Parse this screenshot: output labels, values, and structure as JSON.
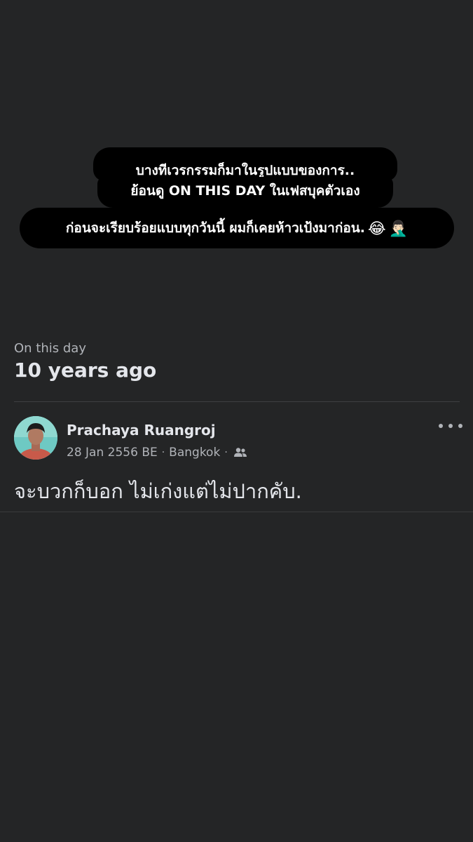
{
  "caption": {
    "line1": "บางทีเวรกรรมก็มาในรูปแบบของการ..",
    "line2": "ย้อนดู ON THIS DAY ในเฟสบุคตัวเอง",
    "line3": "ก่อนจะเรียบร้อยแบบทุกวันนี้ ผมก็เคยห้าวเป้งมาก่อน.",
    "emoji1": "😂",
    "emoji2": "🤦🏻‍♂️"
  },
  "memory": {
    "label": "On this day",
    "heading": "10 years ago"
  },
  "post": {
    "author": "Prachaya Ruangroj",
    "date": "28 Jan 2556 BE",
    "location": "Bangkok",
    "separator": "·",
    "audience_icon": "friends-icon",
    "more_icon": "more-options-icon",
    "text": "จะบวกก็บอก ไม่เก่งแต่ไม่ปากคับ."
  },
  "colors": {
    "background": "#242526",
    "caption_bg": "#000000",
    "primary_text": "#e4e6eb",
    "secondary_text": "#b0b3b8",
    "divider": "#3e4042"
  }
}
